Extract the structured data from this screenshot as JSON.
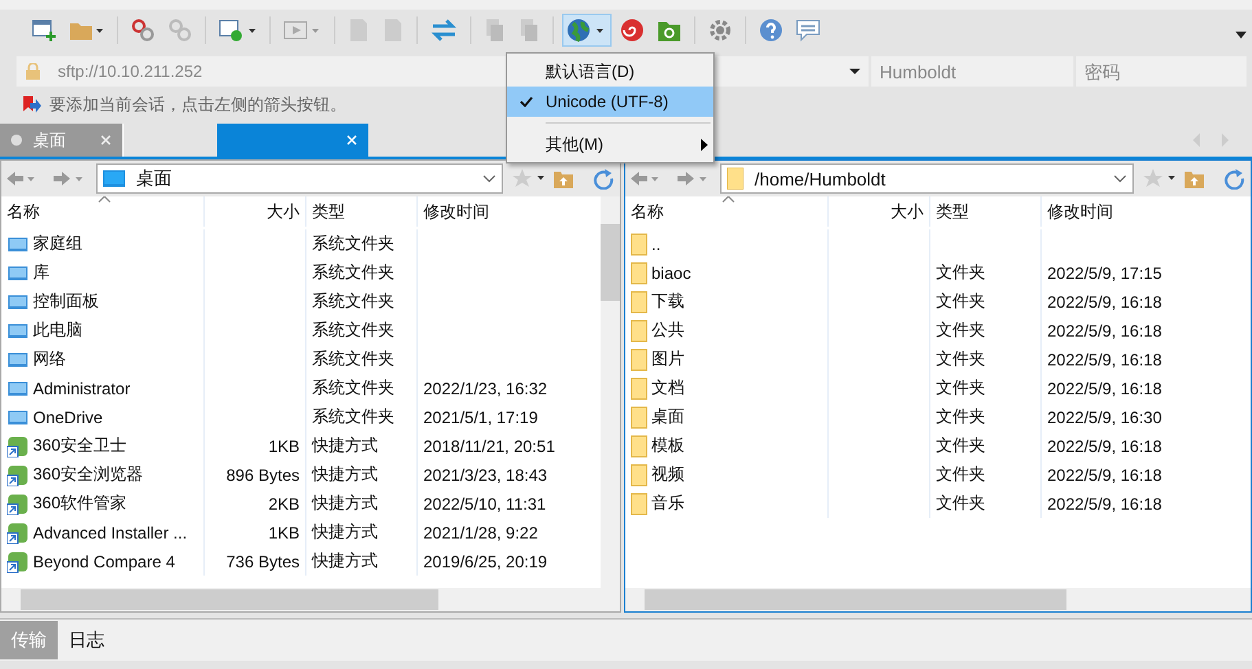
{
  "toolbar": {
    "encoding_menu": {
      "open": true,
      "items": [
        {
          "label": "默认语言(D)",
          "checked": false,
          "submenu": false
        },
        {
          "label": "Unicode (UTF-8)",
          "checked": true,
          "submenu": false
        },
        {
          "label": "其他(M)",
          "checked": false,
          "submenu": true
        }
      ]
    }
  },
  "address_bar": {
    "url": "sftp://10.10.211.252",
    "username": "Humboldt",
    "password_placeholder": "密码"
  },
  "hint": "要添加当前会话，点击左侧的箭头按钮。",
  "session_tabs": [
    {
      "label": "桌面",
      "selected": false
    },
    {
      "selected": true
    }
  ],
  "local_panel": {
    "path": "桌面",
    "columns": [
      "名称",
      "大小",
      "类型",
      "修改时间"
    ],
    "rows": [
      {
        "name": "家庭组",
        "size": "",
        "type": "系统文件夹",
        "modified": "",
        "kind": "system"
      },
      {
        "name": "库",
        "size": "",
        "type": "系统文件夹",
        "modified": "",
        "kind": "system"
      },
      {
        "name": "控制面板",
        "size": "",
        "type": "系统文件夹",
        "modified": "",
        "kind": "system"
      },
      {
        "name": "此电脑",
        "size": "",
        "type": "系统文件夹",
        "modified": "",
        "kind": "system"
      },
      {
        "name": "网络",
        "size": "",
        "type": "系统文件夹",
        "modified": "",
        "kind": "system"
      },
      {
        "name": "Administrator",
        "size": "",
        "type": "系统文件夹",
        "modified": "2022/1/23, 16:32",
        "kind": "system"
      },
      {
        "name": "OneDrive",
        "size": "",
        "type": "系统文件夹",
        "modified": "2021/5/1, 17:19",
        "kind": "system"
      },
      {
        "name": "360安全卫士",
        "size": "1KB",
        "type": "快捷方式",
        "modified": "2018/11/21, 20:51",
        "kind": "shortcut"
      },
      {
        "name": "360安全浏览器",
        "size": "896 Bytes",
        "type": "快捷方式",
        "modified": "2021/3/23, 18:43",
        "kind": "shortcut"
      },
      {
        "name": "360软件管家",
        "size": "2KB",
        "type": "快捷方式",
        "modified": "2022/5/10, 11:31",
        "kind": "shortcut"
      },
      {
        "name": "Advanced Installer ...",
        "size": "1KB",
        "type": "快捷方式",
        "modified": "2021/1/28, 9:22",
        "kind": "shortcut"
      },
      {
        "name": "Beyond Compare 4",
        "size": "736 Bytes",
        "type": "快捷方式",
        "modified": "2019/6/25, 20:19",
        "kind": "shortcut"
      }
    ]
  },
  "remote_panel": {
    "path": "/home/Humboldt",
    "columns": [
      "名称",
      "大小",
      "类型",
      "修改时间"
    ],
    "rows": [
      {
        "name": "..",
        "size": "",
        "type": "",
        "modified": ""
      },
      {
        "name": "biaoc",
        "size": "",
        "type": "文件夹",
        "modified": "2022/5/9, 17:15"
      },
      {
        "name": "下载",
        "size": "",
        "type": "文件夹",
        "modified": "2022/5/9, 16:18"
      },
      {
        "name": "公共",
        "size": "",
        "type": "文件夹",
        "modified": "2022/5/9, 16:18"
      },
      {
        "name": "图片",
        "size": "",
        "type": "文件夹",
        "modified": "2022/5/9, 16:18"
      },
      {
        "name": "文档",
        "size": "",
        "type": "文件夹",
        "modified": "2022/5/9, 16:18"
      },
      {
        "name": "桌面",
        "size": "",
        "type": "文件夹",
        "modified": "2022/5/9, 16:30"
      },
      {
        "name": "模板",
        "size": "",
        "type": "文件夹",
        "modified": "2022/5/9, 16:18"
      },
      {
        "name": "视频",
        "size": "",
        "type": "文件夹",
        "modified": "2022/5/9, 16:18"
      },
      {
        "name": "音乐",
        "size": "",
        "type": "文件夹",
        "modified": "2022/5/9, 16:18"
      }
    ]
  },
  "bottom_tabs": [
    {
      "label": "传输",
      "selected": true
    },
    {
      "label": "日志",
      "selected": false
    }
  ]
}
